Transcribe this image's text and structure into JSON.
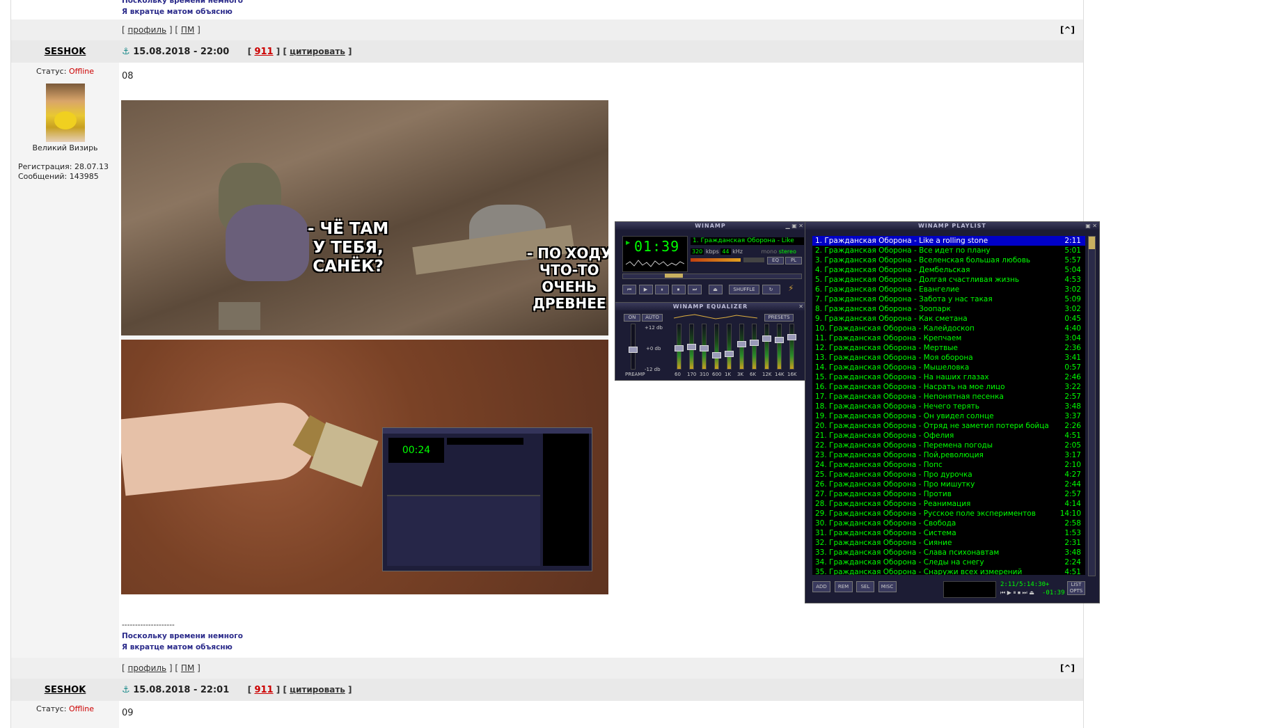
{
  "signature": {
    "line1": "Поскольку времени немного",
    "line2": "Я вкратце матом объясню",
    "separator": "--------------------"
  },
  "actions": {
    "profile": "профиль",
    "pm": "ПМ",
    "top": "[^]"
  },
  "posts": [
    {
      "author": "SESHOK",
      "date": "15.08.2018 - 22:00",
      "number": "911",
      "quote": "цитировать",
      "status_label": "Статус:",
      "status": "Offline",
      "title": "Великий Визирь",
      "reg": "Регистрация: 28.07.13",
      "msgs": "Сообщений: 143985",
      "body": "08"
    },
    {
      "author": "SESHOK",
      "date": "15.08.2018 - 22:01",
      "number": "911",
      "quote": "цитировать",
      "status_label": "Статус:",
      "status": "Offline",
      "body": "09"
    }
  ],
  "meme": {
    "caption1": "- ЧЁ ТАМ\nУ ТЕБЯ,\nСАНЁК?",
    "caption2": "- ПО ХОДУ\nЧТО-ТО\nОЧЕНЬ\nДРЕВНЕЕ"
  },
  "winamp": {
    "title": "WINAMP",
    "time": "01:39",
    "track": "1. Гражданская Оборона - Like",
    "kbps": "320",
    "kbps_label": "kbps",
    "khz": "44",
    "khz_label": "kHz",
    "mono": "mono",
    "stereo": "stereo",
    "shuffle": "SHUFFLE",
    "eq_label": "EQ",
    "pl_label": "PL",
    "eq_title": "WINAMP EQUALIZER",
    "eq_on": "ON",
    "eq_auto": "AUTO",
    "eq_presets": "PRESETS",
    "eq_plus": "+12 db",
    "eq_zero": "+0 db",
    "eq_minus": "-12 db",
    "preamp": "PREAMP",
    "bands": [
      "60",
      "170",
      "310",
      "600",
      "1K",
      "3K",
      "6K",
      "12K",
      "14K",
      "16K"
    ],
    "pl_title": "WINAMP PLAYLIST",
    "pl_add": "ADD",
    "pl_rem": "REM",
    "pl_sel": "SEL",
    "pl_misc": "MISC",
    "pl_list": "LIST OPTS",
    "pl_status": "2:11/5:14:30+",
    "pl_time": "-01:39"
  },
  "playlist": [
    {
      "t": "1. Гражданская Оборона - Like a rolling stone",
      "d": "2:11"
    },
    {
      "t": "2. Гражданская Оборона - Все идет по плану",
      "d": "5:01"
    },
    {
      "t": "3. Гражданская Оборона - Вселенская большая любовь",
      "d": "5:57"
    },
    {
      "t": "4. Гражданская Оборона - Дембельская",
      "d": "5:04"
    },
    {
      "t": "5. Гражданская Оборона - Долгая счастливая жизнь",
      "d": "4:53"
    },
    {
      "t": "6. Гражданская Оборона - Евангелие",
      "d": "3:02"
    },
    {
      "t": "7. Гражданская Оборона - Забота у нас такая",
      "d": "5:09"
    },
    {
      "t": "8. Гражданская Оборона - Зоопарк",
      "d": "3:02"
    },
    {
      "t": "9. Гражданская Оборона - Как сметана",
      "d": "0:45"
    },
    {
      "t": "10. Гражданская Оборона - Калейдоскоп",
      "d": "4:40"
    },
    {
      "t": "11. Гражданская Оборона - Крепчаем",
      "d": "3:04"
    },
    {
      "t": "12. Гражданская Оборона - Мертвые",
      "d": "2:36"
    },
    {
      "t": "13. Гражданская Оборона - Моя оборона",
      "d": "3:41"
    },
    {
      "t": "14. Гражданская Оборона - Мышеловка",
      "d": "0:57"
    },
    {
      "t": "15. Гражданская Оборона - На наших глазах",
      "d": "2:46"
    },
    {
      "t": "16. Гражданская Оборона - Насрать на мое лицо",
      "d": "3:22"
    },
    {
      "t": "17. Гражданская Оборона - Непонятная песенка",
      "d": "2:57"
    },
    {
      "t": "18. Гражданская Оборона - Нечего терять",
      "d": "3:48"
    },
    {
      "t": "19. Гражданская Оборона - Он увидел солнце",
      "d": "3:37"
    },
    {
      "t": "20. Гражданская Оборона - Отряд не заметил потери бойца",
      "d": "2:26"
    },
    {
      "t": "21. Гражданская Оборона - Офелия",
      "d": "4:51"
    },
    {
      "t": "22. Гражданская Оборона - Перемена погоды",
      "d": "2:05"
    },
    {
      "t": "23. Гражданская Оборона - Пой,революция",
      "d": "3:17"
    },
    {
      "t": "24. Гражданская Оборона - Попс",
      "d": "2:10"
    },
    {
      "t": "25. Гражданская Оборона - Про дурочка",
      "d": "4:27"
    },
    {
      "t": "26. Гражданская Оборона - Про мишутку",
      "d": "2:44"
    },
    {
      "t": "27. Гражданская Оборона - Против",
      "d": "2:57"
    },
    {
      "t": "28. Гражданская Оборона - Реанимация",
      "d": "4:14"
    },
    {
      "t": "29. Гражданская Оборона - Русское поле экспериментов",
      "d": "14:10"
    },
    {
      "t": "30. Гражданская Оборона - Свобода",
      "d": "2:58"
    },
    {
      "t": "31. Гражданская Оборона - Система",
      "d": "1:53"
    },
    {
      "t": "32. Гражданская Оборона - Сияние",
      "d": "2:31"
    },
    {
      "t": "33. Гражданская Оборона - Слава психонавтам",
      "d": "3:48"
    },
    {
      "t": "34. Гражданская Оборона - Следы на снегу",
      "d": "2:24"
    },
    {
      "t": "35. Гражданская Оборона - Снаружи всех измерений",
      "d": "4:51"
    }
  ],
  "colors": {
    "playlist_text": "#00ff00",
    "playlist_selected": "#0000c8",
    "offline": "#cc0000"
  }
}
